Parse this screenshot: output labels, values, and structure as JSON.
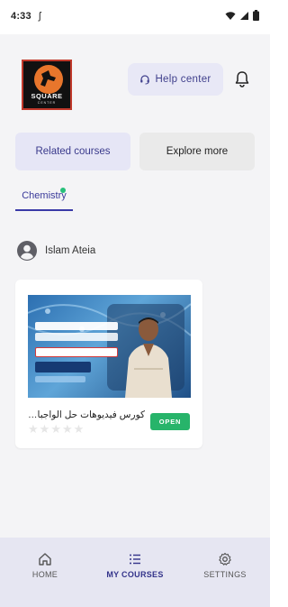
{
  "status_bar": {
    "time": "4:33",
    "extra": "ʃ"
  },
  "header": {
    "logo": {
      "text": "SQUARE",
      "sub": "CENTER",
      "brand_color": "#e8762c"
    },
    "help_button_label": "Help center",
    "help_icon": "headset-icon",
    "notifications_icon": "bell-icon"
  },
  "tabs": {
    "related_label": "Related courses",
    "explore_label": "Explore more",
    "active": "Related courses"
  },
  "subject_tab": {
    "label": "Chemistry",
    "indicator_color": "#27c07a"
  },
  "teacher": {
    "name": "Islam Ateia",
    "avatar_icon": "person-icon"
  },
  "course_card": {
    "title": "كورس فيديوهات حل الواجبات وا...",
    "rating_stars": 5,
    "rating_value": 0,
    "open_label": "OPEN",
    "open_color": "#27b46a"
  },
  "bottom_nav": {
    "items": [
      {
        "label": "HOME",
        "icon": "home-icon"
      },
      {
        "label": "MY COURSES",
        "icon": "list-icon"
      },
      {
        "label": "SETTINGS",
        "icon": "gear-icon"
      }
    ],
    "active": "MY COURSES"
  },
  "colors": {
    "accent": "#3a3a9a",
    "nav_bg": "#e6e6f2",
    "page_bg": "#f4f4f6"
  }
}
